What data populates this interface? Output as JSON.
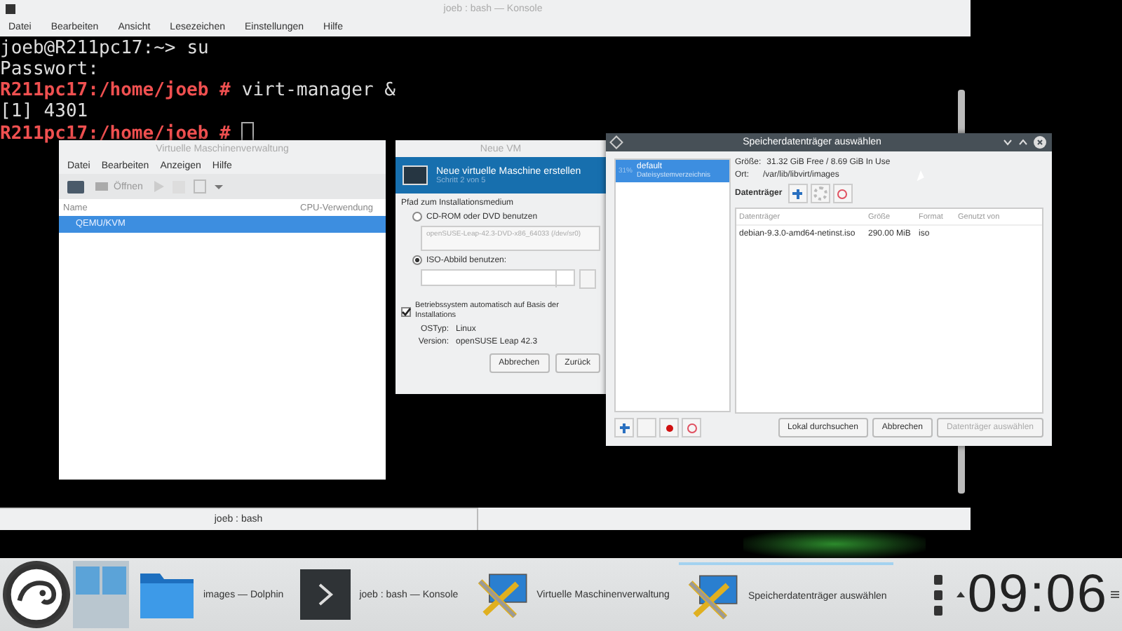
{
  "konsole": {
    "title": "joeb : bash — Konsole",
    "menu": [
      "Datei",
      "Bearbeiten",
      "Ansicht",
      "Lesezeichen",
      "Einstellungen",
      "Hilfe"
    ],
    "lines": [
      {
        "kind": "user",
        "prompt": "joeb@R211pc17:~>",
        "command": "su"
      },
      {
        "kind": "output",
        "text": "Passwort:"
      },
      {
        "kind": "root",
        "prompt": "R211pc17:/home/joeb #",
        "command": "virt-manager &"
      },
      {
        "kind": "output",
        "text": "[1] 4301"
      },
      {
        "kind": "root",
        "prompt": "R211pc17:/home/joeb #",
        "cursor": true
      }
    ],
    "tab": "joeb : bash"
  },
  "vm_manager": {
    "title": "Virtuelle Maschinenverwaltung",
    "menu": [
      "Datei",
      "Bearbeiten",
      "Anzeigen",
      "Hilfe"
    ],
    "open_button": "Öffnen",
    "columns": [
      "Name",
      "CPU-Verwendung"
    ],
    "rows": [
      {
        "name": "QEMU/KVM",
        "selected": true
      }
    ]
  },
  "new_vm": {
    "title": "Neue VM",
    "heading": "Neue virtuelle Maschine erstellen",
    "step": "Schritt 2 von 5",
    "section": "Pfad zum Installationsmedium",
    "options": [
      {
        "label": "CD-ROM oder DVD benutzen",
        "selected": false
      },
      {
        "label": "ISO-Abbild benutzen:",
        "selected": true
      }
    ],
    "cdrom_value": "openSUSE-Leap-42.3-DVD-x86_64033 (/dev/sr0)",
    "autodetect": {
      "label": "Betriebssystem automatisch auf Basis der Installations",
      "checked": true
    },
    "os_type_label": "OSTyp:",
    "os_type": "Linux",
    "version_label": "Version:",
    "version": "openSUSE Leap 42.3",
    "buttons": [
      "Abbrechen",
      "Zurück"
    ]
  },
  "storage_dialog": {
    "title": "Speicherdatenträger auswählen",
    "pools": [
      {
        "usage": "31%",
        "name": "default",
        "type": "Dateisystemverzeichnis",
        "selected": true
      }
    ],
    "size_label": "Größe:",
    "size": "31.32 GiB Free / 8.69 GiB In Use",
    "location_label": "Ort:",
    "location": "/var/lib/libvirt/images",
    "volumes_label": "Datenträger",
    "columns": [
      "Datenträger",
      "Größe",
      "Format",
      "Genutzt von"
    ],
    "volumes": [
      {
        "name": "debian-9.3.0-amd64-netinst.iso",
        "size": "290.00 MiB",
        "format": "iso"
      }
    ],
    "buttons": [
      {
        "label": "Lokal durchsuchen",
        "disabled": false
      },
      {
        "label": "Abbrechen",
        "disabled": false
      },
      {
        "label": "Datenträger auswählen",
        "disabled": true
      }
    ]
  },
  "taskbar": {
    "tasks": [
      {
        "kind": "folder",
        "label": "images — Dolphin",
        "selected": false
      },
      {
        "kind": "terminal",
        "label": "joeb : bash — Konsole",
        "selected": false
      },
      {
        "kind": "vm",
        "label": "Virtuelle Maschinenverwaltung",
        "selected": false
      },
      {
        "kind": "vm",
        "label": "Speicherdatenträger auswählen",
        "selected": true
      }
    ],
    "clock": "09:06"
  }
}
